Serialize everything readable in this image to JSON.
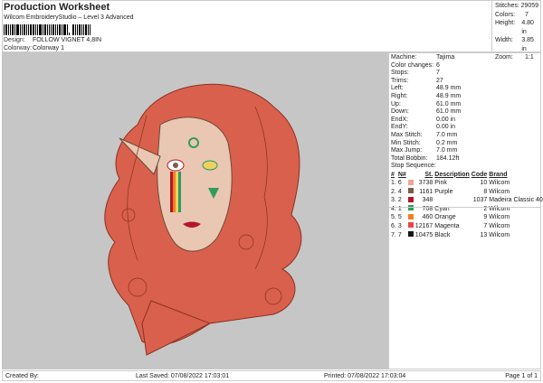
{
  "header": {
    "title": "Production Worksheet",
    "subtitle": "Wilcom EmbroideryStudio – Level 3 Advanced",
    "design_label": "Design:",
    "design_value": "FOLLOW VIGNET 4,8IN",
    "colorway_label": "Colorway:",
    "colorway_value": "Colorway 1"
  },
  "stats": [
    {
      "k": "Stitches:",
      "v": "29059"
    },
    {
      "k": "Colors:",
      "v": "7"
    },
    {
      "k": "Height:",
      "v": "4.80 in"
    },
    {
      "k": "Width:",
      "v": "3.85 in"
    },
    {
      "k": "Zoom:",
      "v": "1:1"
    }
  ],
  "info": [
    {
      "k": "Machine:",
      "v": "Tajima"
    },
    {
      "k": "Color changes:",
      "v": "6"
    },
    {
      "k": "Stops:",
      "v": "7"
    },
    {
      "k": "Trims:",
      "v": "27"
    },
    {
      "k": "Left:",
      "v": "48.9 mm"
    },
    {
      "k": "Right:",
      "v": "48.9 mm"
    },
    {
      "k": "Up:",
      "v": "61.0 mm"
    },
    {
      "k": "Down:",
      "v": "61.0 mm"
    },
    {
      "k": "EndX:",
      "v": "0.00 in"
    },
    {
      "k": "EndY:",
      "v": "0.00 in"
    },
    {
      "k": "Max Stitch:",
      "v": "7.0 mm"
    },
    {
      "k": "Min Stitch:",
      "v": "0.2 mm"
    },
    {
      "k": "Max Jump:",
      "v": "7.0 mm"
    },
    {
      "k": "Total Bobbin:",
      "v": "184.12ft"
    }
  ],
  "stop_sequence": {
    "title": "Stop Sequence:",
    "headers": [
      "#",
      "N#",
      "St.",
      "Description",
      "Code",
      "Brand"
    ],
    "rows": [
      {
        "n": "1.",
        "num": "6",
        "color": "#f0a494",
        "st": "3738",
        "desc": "Pink",
        "code": "10",
        "brand": "Wilcom"
      },
      {
        "n": "2.",
        "num": "4",
        "color": "#7d5a48",
        "st": "1161",
        "desc": "Purple",
        "code": "8",
        "brand": "Wilcom"
      },
      {
        "n": "3.",
        "num": "2",
        "color": "#b5142a",
        "st": "348",
        "desc": "",
        "code": "1037",
        "brand": "Madeira Classic 40"
      },
      {
        "n": "4.",
        "num": "1",
        "color": "#2e9c5e",
        "st": "708",
        "desc": "Cyan",
        "code": "2",
        "brand": "Wilcom"
      },
      {
        "n": "5.",
        "num": "5",
        "color": "#f08020",
        "st": "460",
        "desc": "Orange",
        "code": "9",
        "brand": "Wilcom"
      },
      {
        "n": "6.",
        "num": "3",
        "color": "#f04444",
        "st": "12167",
        "desc": "Magenta",
        "code": "7",
        "brand": "Wilcom"
      },
      {
        "n": "7.",
        "num": "7",
        "color": "#151515",
        "st": "10475",
        "desc": "Black",
        "code": "13",
        "brand": "Wilcom"
      }
    ]
  },
  "footer": {
    "created": "Created By:",
    "saved": "Last Saved: 07/08/2022 17:03:01",
    "printed": "Printed: 07/08/2022 17:03:04",
    "page": "Page 1 of 1"
  }
}
